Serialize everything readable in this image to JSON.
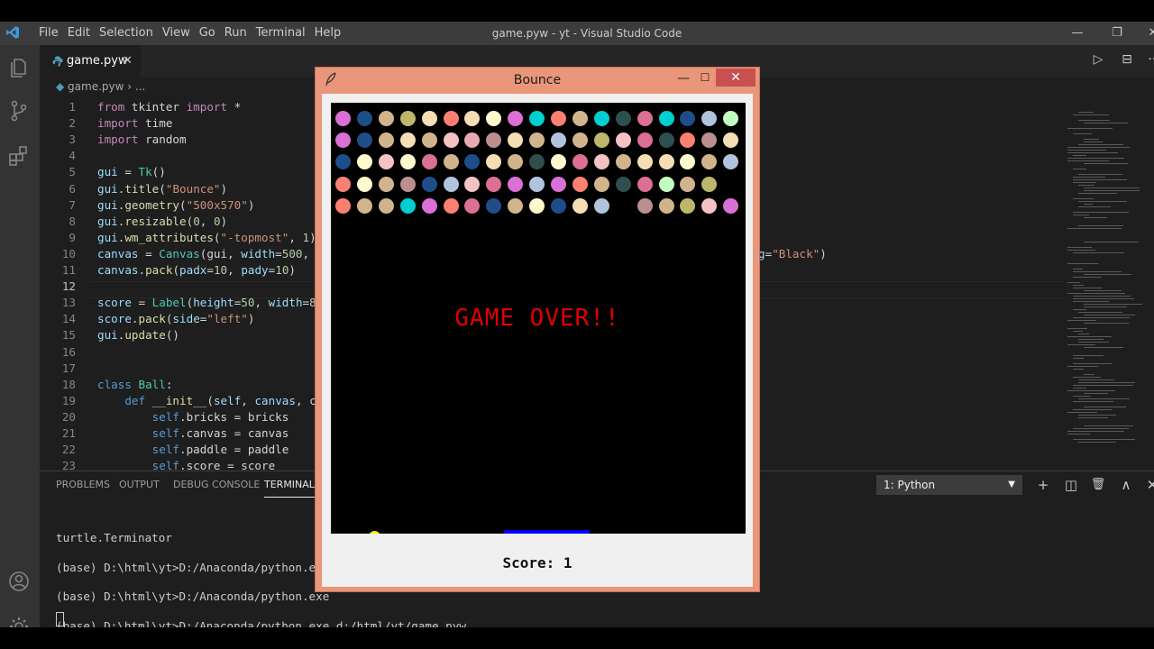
{
  "vscode": {
    "menu": [
      "File",
      "Edit",
      "Selection",
      "View",
      "Go",
      "Run",
      "Terminal",
      "Help"
    ],
    "window_title": "game.pyw - yt - Visual Studio Code",
    "window_controls": {
      "minimize": "—",
      "restore": "❐",
      "close": "✕"
    },
    "tab": {
      "name": "game.pyw",
      "close": "✕"
    },
    "breadcrumb": {
      "file": "game.pyw",
      "sep": " › ",
      "rest": "..."
    },
    "editor_actions": {
      "run": "▷",
      "split": "⊟",
      "more": "···"
    },
    "code_lines": [
      {
        "n": "1",
        "tokens": [
          [
            "k",
            "from"
          ],
          [
            "p",
            " tkinter "
          ],
          [
            "k",
            "import"
          ],
          [
            "p",
            " *"
          ]
        ]
      },
      {
        "n": "2",
        "tokens": [
          [
            "k",
            "import"
          ],
          [
            "p",
            " time"
          ]
        ]
      },
      {
        "n": "3",
        "tokens": [
          [
            "k",
            "import"
          ],
          [
            "p",
            " random"
          ]
        ]
      },
      {
        "n": "4",
        "tokens": []
      },
      {
        "n": "5",
        "tokens": [
          [
            "v",
            "gui"
          ],
          [
            "p",
            " = "
          ],
          [
            "c",
            "Tk"
          ],
          [
            "p",
            "()"
          ]
        ]
      },
      {
        "n": "6",
        "tokens": [
          [
            "v",
            "gui"
          ],
          [
            "p",
            "."
          ],
          [
            "f",
            "title"
          ],
          [
            "p",
            "("
          ],
          [
            "s",
            "\"Bounce\""
          ],
          [
            "p",
            ")"
          ]
        ]
      },
      {
        "n": "7",
        "tokens": [
          [
            "v",
            "gui"
          ],
          [
            "p",
            "."
          ],
          [
            "f",
            "geometry"
          ],
          [
            "p",
            "("
          ],
          [
            "s",
            "\"500x570\""
          ],
          [
            "p",
            ")"
          ]
        ]
      },
      {
        "n": "8",
        "tokens": [
          [
            "v",
            "gui"
          ],
          [
            "p",
            "."
          ],
          [
            "f",
            "resizable"
          ],
          [
            "p",
            "("
          ],
          [
            "n",
            "0"
          ],
          [
            "p",
            ", "
          ],
          [
            "n",
            "0"
          ],
          [
            "p",
            ")"
          ]
        ]
      },
      {
        "n": "9",
        "tokens": [
          [
            "v",
            "gui"
          ],
          [
            "p",
            "."
          ],
          [
            "f",
            "wm_attributes"
          ],
          [
            "p",
            "("
          ],
          [
            "s",
            "\"-topmost\""
          ],
          [
            "p",
            ", "
          ],
          [
            "n",
            "1"
          ],
          [
            "p",
            ")"
          ]
        ]
      },
      {
        "n": "10",
        "tokens": [
          [
            "v",
            "canvas"
          ],
          [
            "p",
            " = "
          ],
          [
            "c",
            "Canvas"
          ],
          [
            "p",
            "(gui, "
          ],
          [
            "v",
            "width"
          ],
          [
            "p",
            "="
          ],
          [
            "n",
            "500"
          ],
          [
            "p",
            ", h"
          ]
        ]
      },
      {
        "n": "11",
        "tokens": [
          [
            "v",
            "canvas"
          ],
          [
            "p",
            "."
          ],
          [
            "f",
            "pack"
          ],
          [
            "p",
            "("
          ],
          [
            "v",
            "padx"
          ],
          [
            "p",
            "="
          ],
          [
            "n",
            "10"
          ],
          [
            "p",
            ", "
          ],
          [
            "v",
            "pady"
          ],
          [
            "p",
            "="
          ],
          [
            "n",
            "10"
          ],
          [
            "p",
            ")"
          ]
        ]
      },
      {
        "n": "12",
        "tokens": []
      },
      {
        "n": "13",
        "tokens": [
          [
            "v",
            "score"
          ],
          [
            "p",
            " = "
          ],
          [
            "c",
            "Label"
          ],
          [
            "p",
            "("
          ],
          [
            "v",
            "height"
          ],
          [
            "p",
            "="
          ],
          [
            "n",
            "50"
          ],
          [
            "p",
            ", "
          ],
          [
            "v",
            "width"
          ],
          [
            "p",
            "="
          ],
          [
            "n",
            "80"
          ]
        ]
      },
      {
        "n": "14",
        "tokens": [
          [
            "v",
            "score"
          ],
          [
            "p",
            "."
          ],
          [
            "f",
            "pack"
          ],
          [
            "p",
            "("
          ],
          [
            "v",
            "side"
          ],
          [
            "p",
            "="
          ],
          [
            "s",
            "\"left\""
          ],
          [
            "p",
            ")"
          ]
        ]
      },
      {
        "n": "15",
        "tokens": [
          [
            "v",
            "gui"
          ],
          [
            "p",
            "."
          ],
          [
            "f",
            "update"
          ],
          [
            "p",
            "()"
          ]
        ]
      },
      {
        "n": "16",
        "tokens": []
      },
      {
        "n": "17",
        "tokens": []
      },
      {
        "n": "18",
        "tokens": [
          [
            "b",
            "class"
          ],
          [
            "p",
            " "
          ],
          [
            "c",
            "Ball"
          ],
          [
            "p",
            ":"
          ]
        ]
      },
      {
        "n": "19",
        "tokens": [
          [
            "p",
            "    "
          ],
          [
            "b",
            "def"
          ],
          [
            "p",
            " "
          ],
          [
            "f",
            "__init__"
          ],
          [
            "p",
            "("
          ],
          [
            "v",
            "self"
          ],
          [
            "p",
            ", "
          ],
          [
            "v",
            "canvas"
          ],
          [
            "p",
            ", co"
          ]
        ]
      },
      {
        "n": "20",
        "tokens": [
          [
            "p",
            "        "
          ],
          [
            "b",
            "self"
          ],
          [
            "p",
            ".bricks = bricks"
          ]
        ]
      },
      {
        "n": "21",
        "tokens": [
          [
            "p",
            "        "
          ],
          [
            "b",
            "self"
          ],
          [
            "p",
            ".canvas = canvas"
          ]
        ]
      },
      {
        "n": "22",
        "tokens": [
          [
            "p",
            "        "
          ],
          [
            "b",
            "self"
          ],
          [
            "p",
            ".paddle = paddle"
          ]
        ]
      },
      {
        "n": "23",
        "tokens": [
          [
            "p",
            "        "
          ],
          [
            "b",
            "self"
          ],
          [
            "p",
            ".score = score"
          ]
        ]
      }
    ],
    "line10_tail": [
      [
        "v",
        "g"
      ],
      [
        "p",
        "="
      ],
      [
        "s",
        "\"Black\""
      ],
      [
        "p",
        ")"
      ]
    ],
    "current_line": "12",
    "panel": {
      "tabs": [
        "PROBLEMS",
        "OUTPUT",
        "DEBUG CONSOLE",
        "TERMINAL"
      ],
      "active_tab": "TERMINAL",
      "terminal_select": "1: Python",
      "icons": {
        "add": "+",
        "split": "◫",
        "trash": "🗑",
        "maximize": "∧",
        "close": "✕"
      },
      "terminal_lines": [
        "turtle.Terminator",
        "",
        "(base) D:\\html\\yt>D:/Anaconda/python.exe",
        "",
        "(base) D:\\html\\yt>D:/Anaconda/python.exe",
        "",
        "(base) D:\\html\\yt>D:/Anaconda/python.exe d:/html/yt/game.pyw"
      ]
    }
  },
  "tk_window": {
    "title": "Bounce",
    "controls": {
      "minimize": "—",
      "maximize": "☐",
      "close": "✕"
    },
    "game_over_text": "GAME OVER!!",
    "score_text": "Score: 1",
    "colors": {
      "canvas": "#000000",
      "paddle": "#0000ff",
      "ball": "#ffee00",
      "game_over": "#e00000",
      "frame": "#e9967a"
    },
    "brick_rows": [
      [
        "#da70d6",
        "#1d4e89",
        "#d2b48c",
        "#bdb76b",
        "#f5deb3",
        "#fa8072",
        "#f5deb3",
        "#fffacd",
        "#da70d6",
        "#00ced1",
        "#fa8072",
        "#d2b48c",
        "#00ced1",
        "#2f4f4f",
        "#db7093",
        "#00ced1",
        "#1d4e89",
        "#b0c4de",
        "#c1ffc1"
      ],
      [
        "#da70d6",
        "#1d4e89",
        "#d2b48c",
        "#f5deb3",
        "#d2b48c",
        "#f4c2c2",
        "#e8a9b0",
        "#bc8f8f",
        "#f5deb3",
        "#d2b48c",
        "#b0c4de",
        "#d2b48c",
        "#bdb76b",
        "#f4c2c2",
        "#db7093",
        "#2f4f4f",
        "#fa8072",
        "#bc8f8f",
        "#f5deb3"
      ],
      [
        "#1d4e89",
        "#fffacd",
        "#f4c2c2",
        "#fffacd",
        "#db7093",
        "#d2b48c",
        "#1d4e89",
        "#f5deb3",
        "#d2b48c",
        "#2f4f4f",
        "#fffacd",
        "#db7093",
        "#f4c2c2",
        "#d2b48c",
        "#f5deb3",
        "#f5deb3",
        "#fffacd",
        "#d2b48c",
        "#b0c4de"
      ],
      [
        "#fa8072",
        "#fffacd",
        "#d2b48c",
        "#bc8f8f",
        "#1d4e89",
        "#b0c4de",
        "#f4c2c2",
        "#db7093",
        "#da70d6",
        "#b0c4de",
        "#da70d6",
        "#fa8072",
        "#d2b48c",
        "#2f4f4f",
        "#db7093",
        "#c1ffc1",
        "#d2b48c",
        "#bdb76b"
      ],
      [
        "#fa8072",
        "#d2b48c",
        "#d2b48c",
        "#00ced1",
        "#da70d6",
        "#fa8072",
        "#db7093",
        "#1d4e89",
        "#d2b48c",
        "#fffacd",
        "#1d4e89",
        "#f5deb3",
        "#b0c4de",
        "",
        "#bc8f8f",
        "#d2b48c",
        "#bdb76b",
        "#f4c2c2",
        "#da70d6"
      ]
    ]
  }
}
